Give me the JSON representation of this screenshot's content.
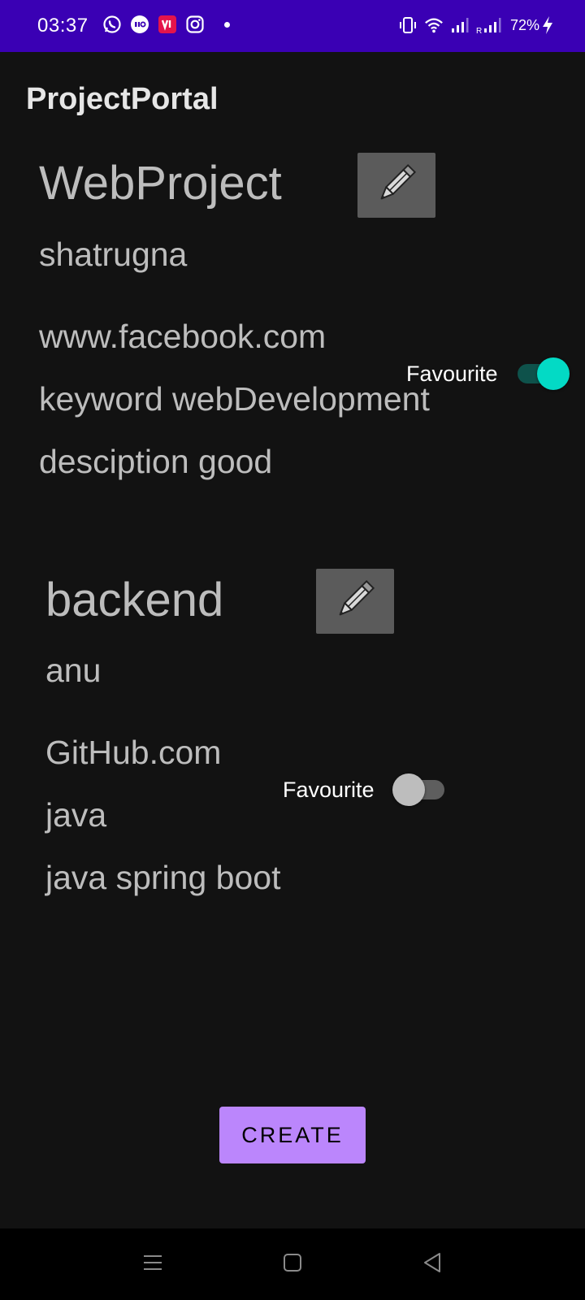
{
  "status_bar": {
    "time": "03:37",
    "battery": "72%",
    "left_icons": [
      "whatsapp-icon",
      "jio-icon",
      "vi-icon",
      "instagram-icon",
      "notification-dot-icon"
    ],
    "right_icons": [
      "vibrate-icon",
      "wifi-icon",
      "signal-icon",
      "roaming-signal-icon",
      "charging-icon"
    ],
    "roaming_label": "R",
    "background_color": "#3A00B4"
  },
  "app_bar": {
    "title": "ProjectPortal"
  },
  "projects": [
    {
      "name": "WebProject",
      "owner": "shatrugna",
      "url": "www.facebook.com",
      "keyword": "keyword webDevelopment",
      "description": "desciption good",
      "favourite_label": "Favourite",
      "favourite": true,
      "edit_icon": "pencil-icon"
    },
    {
      "name": "backend",
      "owner": "anu",
      "url": "GitHub.com",
      "keyword": "java",
      "description": "java spring boot",
      "favourite_label": "Favourite",
      "favourite": false,
      "edit_icon": "pencil-icon"
    }
  ],
  "create_button": {
    "label": "CREATE",
    "color": "#bb86fc"
  },
  "nav_bar": {
    "icons": [
      "menu-icon",
      "home-icon",
      "back-icon"
    ]
  },
  "colors": {
    "background": "#121212",
    "switch_on": "#03dac5",
    "switch_off": "#bdbdbd"
  }
}
